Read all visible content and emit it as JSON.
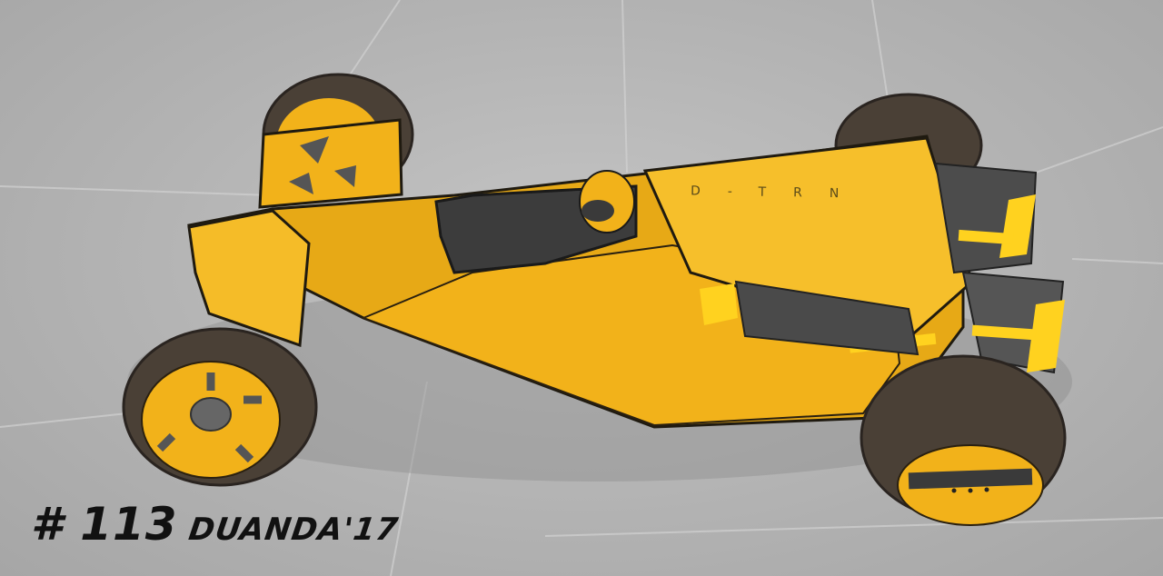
{
  "artwork": {
    "background_color": "#b8b8b8",
    "body_color": "#f2b21a",
    "body_shadow_color": "#c98e0c",
    "tire_color": "#4a4036",
    "light_color": "#ffd21f"
  },
  "car": {
    "lettering": "D-TRN"
  },
  "signature": {
    "number": "# 113",
    "name": "DUANDA'17"
  }
}
